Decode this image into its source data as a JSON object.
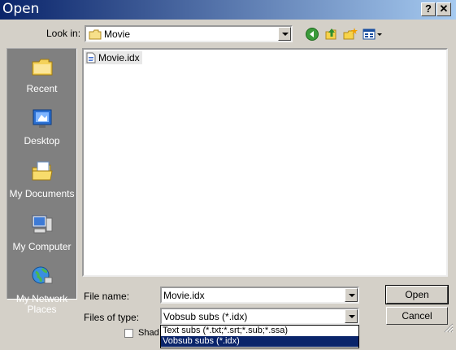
{
  "window": {
    "title": "Open"
  },
  "title_buttons": {
    "help": "?",
    "close": "✕"
  },
  "look_in": {
    "label": "Look in:",
    "value": "Movie"
  },
  "toolbar": {
    "icons": [
      "back-icon",
      "up-folder-icon",
      "new-folder-icon",
      "view-menu-icon"
    ]
  },
  "places": [
    {
      "label": "Recent",
      "icon": "recent-icon"
    },
    {
      "label": "Desktop",
      "icon": "desktop-icon"
    },
    {
      "label": "My Documents",
      "icon": "my-documents-icon"
    },
    {
      "label": "My Computer",
      "icon": "my-computer-icon"
    },
    {
      "label": "My Network Places",
      "icon": "network-places-icon"
    }
  ],
  "files": [
    {
      "name": "Movie.idx",
      "icon": "file-icon"
    }
  ],
  "file_name": {
    "label": "File name:",
    "value": "Movie.idx"
  },
  "file_type": {
    "label": "Files of type:",
    "value": "Vobsub subs (*.idx)",
    "options": [
      "Text subs (*.txt;*.srt;*.sub;*.ssa)",
      "Vobsub subs (*.idx)"
    ],
    "selected_index": 1
  },
  "buttons": {
    "open": "Open",
    "cancel": "Cancel"
  },
  "hidden_checkbox": {
    "label_partial": "Shad"
  },
  "colors": {
    "title_start": "#0a246a",
    "title_end": "#a6caf0",
    "dialog": "#d4d0c8",
    "places_bg": "#808080",
    "selection": "#0a246a"
  }
}
